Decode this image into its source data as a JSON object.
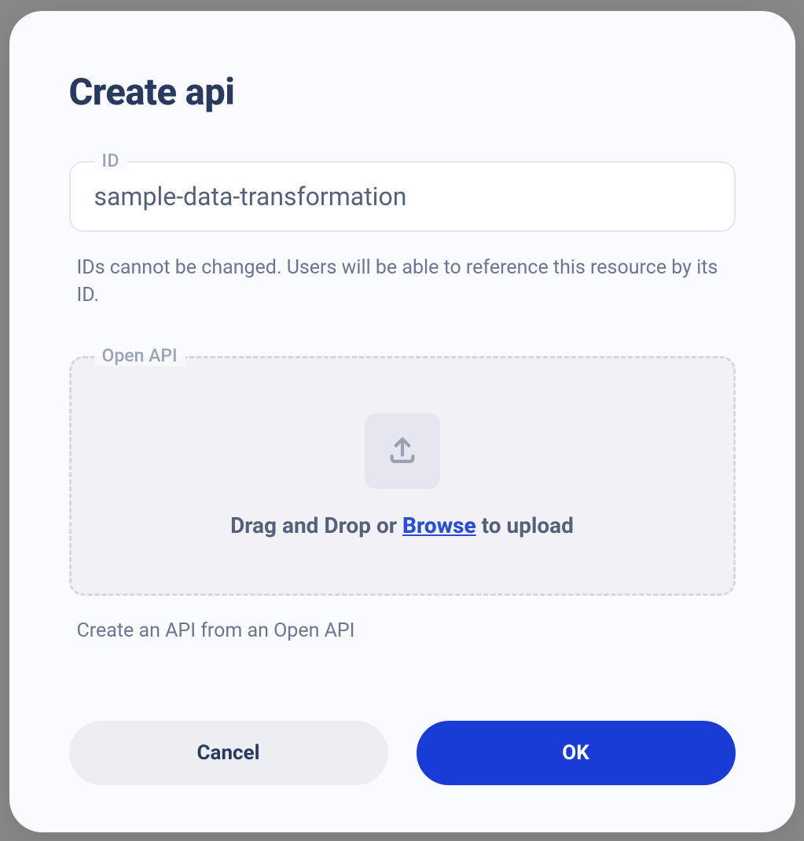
{
  "modal": {
    "title": "Create api",
    "idField": {
      "label": "ID",
      "value": "sample-data-transformation",
      "helper": "IDs cannot be changed. Users will be able to reference this resource by its ID."
    },
    "openApi": {
      "label": "Open API",
      "dragText": "Drag and Drop or ",
      "browseText": "Browse",
      "uploadText": " to upload",
      "helper": "Create an API from an Open API"
    },
    "buttons": {
      "cancel": "Cancel",
      "ok": "OK"
    }
  }
}
